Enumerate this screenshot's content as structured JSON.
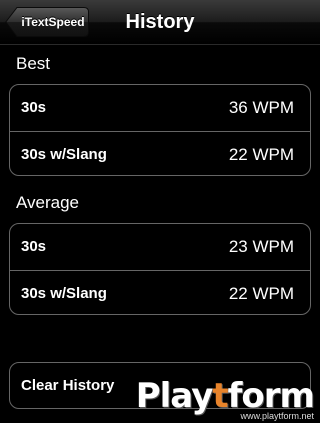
{
  "navbar": {
    "back_label": "iTextSpeed",
    "title": "History"
  },
  "best": {
    "header": "Best",
    "rows": [
      {
        "name": "30s",
        "value": "36 WPM"
      },
      {
        "name": "30s w/Slang",
        "value": "22 WPM"
      }
    ]
  },
  "average": {
    "header": "Average",
    "rows": [
      {
        "name": "30s",
        "value": "23 WPM"
      },
      {
        "name": "30s w/Slang",
        "value": "22 WPM"
      }
    ]
  },
  "clear_history_label": "Clear History",
  "watermark": {
    "logo_prefix": "Play",
    "logo_accent": "t",
    "logo_suffix": "form",
    "url": "www.playtform.net"
  }
}
